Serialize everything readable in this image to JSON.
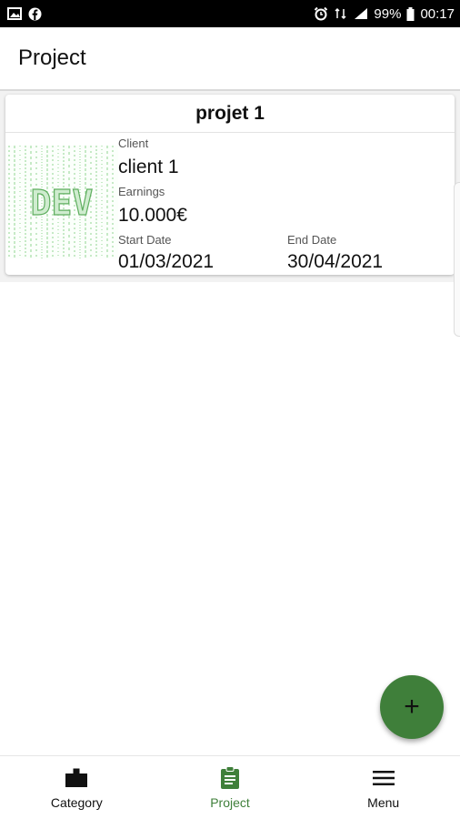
{
  "status_bar": {
    "battery": "99%",
    "time": "00:17",
    "icons": [
      "image-icon",
      "facebook-icon",
      "alarm-icon",
      "4g-icon",
      "signal-icon",
      "battery-icon"
    ]
  },
  "app_bar": {
    "title": "Project"
  },
  "project_card": {
    "title": "projet 1",
    "thumbnail_text": "DEV",
    "client_label": "Client",
    "client_value": "client 1",
    "earnings_label": "Earnings",
    "earnings_value": "10.000€",
    "start_label": "Start Date",
    "start_value": "01/03/2021",
    "end_label": "End Date",
    "end_value": "30/04/2021"
  },
  "fab": {
    "icon": "plus-icon",
    "symbol": "+",
    "color": "#3f7f3a"
  },
  "bottom_nav": {
    "items": [
      {
        "label": "Category",
        "icon": "folder-icon",
        "active": false
      },
      {
        "label": "Project",
        "icon": "clipboard-icon",
        "active": true
      },
      {
        "label": "Menu",
        "icon": "menu-icon",
        "active": false
      }
    ],
    "active_color": "#3f7f3a"
  }
}
